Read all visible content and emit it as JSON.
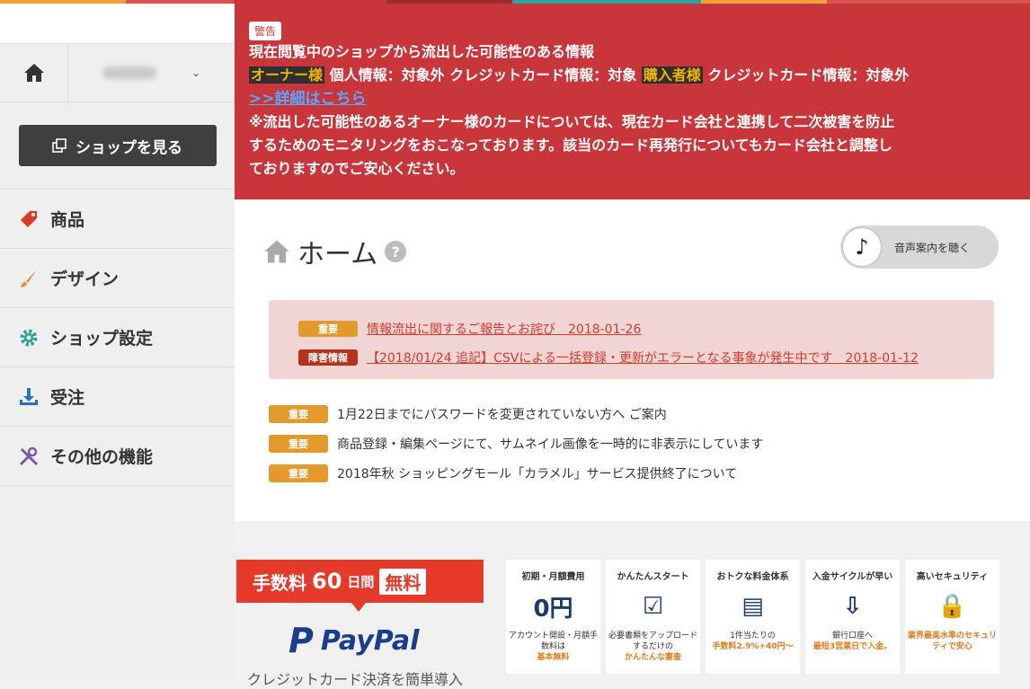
{
  "sidebar": {
    "shop_button_label": "ショップを見る",
    "menu": [
      {
        "label": "商品",
        "icon": "tag-icon"
      },
      {
        "label": "デザイン",
        "icon": "brush-icon"
      },
      {
        "label": "ショップ設定",
        "icon": "gear-icon"
      },
      {
        "label": "受注",
        "icon": "download-icon"
      },
      {
        "label": "その他の機能",
        "icon": "tools-icon"
      }
    ]
  },
  "warning": {
    "badge": "警告",
    "headline": "現在閲覧中のショップから流出した可能性のある情報",
    "owner_label": "オーナー様",
    "owner_personal": "個人情報：対象外",
    "owner_card": "クレジットカード情報：対象",
    "buyer_label": "購入者様",
    "buyer_card": "クレジットカード情報：対象外",
    "details_link": ">>詳細はこちら",
    "note_lines": [
      "※流出した可能性のあるオーナー様のカードについては、現在カード会社と連携して二次被害を防止",
      "するためのモニタリングをおこなっております。該当のカード再発行についてもカード会社と調整し",
      "ておりますのでご安心ください。"
    ]
  },
  "main": {
    "title": "ホーム",
    "help": "?",
    "voice_button": "音声案内を聴く",
    "pinned_notices": [
      {
        "tag": "重要",
        "tag_color": "#e39a2d",
        "text": "情報流出に関するご報告とお詫び　2018-01-26"
      },
      {
        "tag": "障害情報",
        "tag_color": "#b3331d",
        "text": "【2018/01/24 追記】CSVによる一括登録・更新がエラーとなる事象が発生中です　2018-01-12"
      }
    ],
    "notices": [
      {
        "tag": "重要",
        "text": "1月22日までにパスワードを変更されていない方へ ご案内"
      },
      {
        "tag": "重要",
        "text": "商品登録・編集ページにて、サムネイル画像を一時的に非表示にしています"
      },
      {
        "tag": "重要",
        "text": "2018年秋 ショッピングモール「カラメル」サービス提供終了について"
      }
    ]
  },
  "promo": {
    "fee": "手数料",
    "days": "60",
    "days_unit": "日間",
    "free": "無料",
    "paypal": "PayPal",
    "subtitle": "クレジットカード決済を簡単導入",
    "features": [
      {
        "title": "初期・月額費用",
        "icon_text": "0円",
        "desc": "アカウント開設・月額手数料は",
        "emph": "基本無料"
      },
      {
        "title": "かんたんスタート",
        "icon_text": "☑",
        "desc": "必要書類をアップロードするだけの",
        "emph": "かんたんな審査"
      },
      {
        "title": "おトクな料金体系",
        "icon_text": "▤",
        "desc": "1件当たりの",
        "emph": "手数料2.9%+40円〜"
      },
      {
        "title": "入金サイクルが早い",
        "icon_text": "⇩",
        "desc": "銀行口座へ",
        "emph": "最短3営業日で入金。"
      },
      {
        "title": "高いセキュリティ",
        "icon_text": "🔒",
        "desc": "",
        "emph": "業界最高水準のセキュリティで安心"
      }
    ]
  },
  "colors": {
    "warning_bg": "#c8353a",
    "sidebar_bg": "#efefef",
    "important_tag": "#e39a2d",
    "fault_tag": "#b3331d",
    "link_red": "#d23b2a"
  }
}
